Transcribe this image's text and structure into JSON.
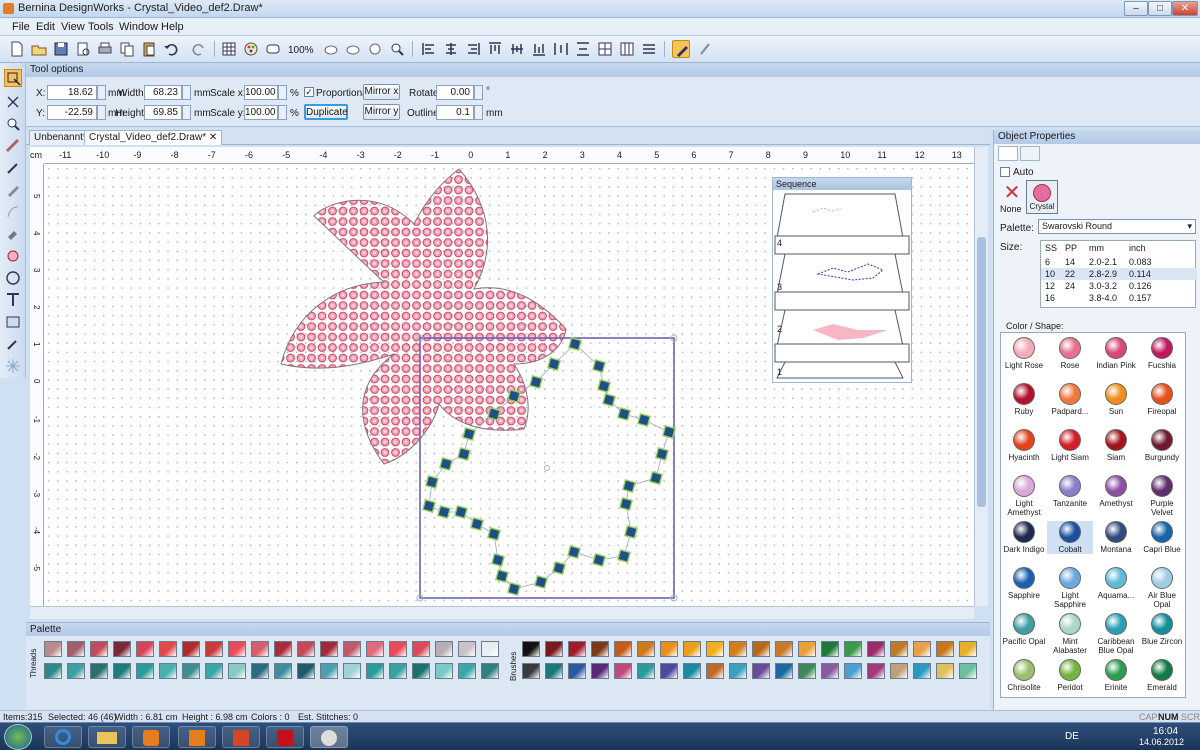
{
  "window": {
    "title": "Bernina DesignWorks - Crystal_Video_def2.Draw*",
    "min": "–",
    "max": "□",
    "close": "✕"
  },
  "menu": [
    "File",
    "Edit",
    "View",
    "Tools",
    "Window",
    "Help"
  ],
  "toolbar": {
    "zoom": "100%"
  },
  "tool_options": {
    "header": "Tool options",
    "x_label": "X:",
    "x_value": "18.62",
    "x_unit": "mm",
    "y_label": "Y:",
    "y_value": "-22.59",
    "y_unit": "mm",
    "width_label": "Width:",
    "width_value": "68.23",
    "width_unit": "mm",
    "height_label": "Height:",
    "height_value": "69.85",
    "height_unit": "mm",
    "scalex_label": "Scale x:",
    "scalex_value": "100.00",
    "scalex_unit": "%",
    "scaley_label": "Scale y:",
    "scaley_value": "100.00",
    "scaley_unit": "%",
    "proportional_label": "Proportional",
    "duplicate": "Duplicate",
    "mirror_x": "Mirror x",
    "mirror_y": "Mirror y",
    "rotate_label": "Rotate:",
    "rotate_value": "0.00",
    "rotate_unit": "°",
    "outline_label": "Outline:",
    "outline_value": "0.1",
    "outline_unit": "mm"
  },
  "doc_tabs": [
    "Unbenannt*",
    "Crystal_Video_def2.Draw*"
  ],
  "ruler": {
    "unit": "cm",
    "h_ticks": [
      "-11",
      "-10",
      "-9",
      "-8",
      "-7",
      "-6",
      "-5",
      "-4",
      "-3",
      "-2",
      "-1",
      "0",
      "1",
      "2",
      "3",
      "4",
      "5",
      "6",
      "7",
      "8",
      "9",
      "10",
      "11",
      "12",
      "13"
    ],
    "v_ticks": [
      "5",
      "4",
      "3",
      "2",
      "1",
      "0",
      "-1",
      "-2",
      "-3",
      "-4",
      "-5"
    ]
  },
  "sequence": {
    "title": "Sequence",
    "items": [
      "4",
      "3",
      "2",
      "1"
    ]
  },
  "palette": {
    "title": "Palette",
    "threads_label": "Threads",
    "brushes_label": "Brushes"
  },
  "object_properties": {
    "title": "Object Properties",
    "auto_label": "Auto",
    "none_label": "None",
    "crystal_label": "Crystal",
    "palette_label": "Palette:",
    "palette_value": "Swarovski Round",
    "size_label": "Size:",
    "size_headers": [
      "SS",
      "PP",
      "mm",
      "inch"
    ],
    "sizes": [
      [
        "6",
        "14",
        "2.0-2.1",
        "0.083"
      ],
      [
        "10",
        "22",
        "2.8-2.9",
        "0.114"
      ],
      [
        "12",
        "24",
        "3.0-3.2",
        "0.126"
      ],
      [
        "16",
        "",
        "3.8-4.0",
        "0.157"
      ]
    ],
    "color_label": "Color / Shape:",
    "colors": [
      {
        "name": "Light Rose",
        "color": "#f2aab8"
      },
      {
        "name": "Rose",
        "color": "#e8708e"
      },
      {
        "name": "Indian Pink",
        "color": "#d8457a"
      },
      {
        "name": "Fucshia",
        "color": "#c2165f"
      },
      {
        "name": "Ruby",
        "color": "#b3122e"
      },
      {
        "name": "Padpard...",
        "color": "#f1773d"
      },
      {
        "name": "Sun",
        "color": "#f08d1a"
      },
      {
        "name": "Fireopal",
        "color": "#e8501b"
      },
      {
        "name": "Hyacinth",
        "color": "#e1421e"
      },
      {
        "name": "Light Siam",
        "color": "#d21e26"
      },
      {
        "name": "Siam",
        "color": "#a3141e"
      },
      {
        "name": "Burgundy",
        "color": "#6e1a2c"
      },
      {
        "name": "Light Amethyst",
        "color": "#d8a8d6"
      },
      {
        "name": "Tanzanite",
        "color": "#8a7cc8"
      },
      {
        "name": "Amethyst",
        "color": "#8e4fa0"
      },
      {
        "name": "Purple Velvet",
        "color": "#5e2f6e"
      },
      {
        "name": "Dark Indigo",
        "color": "#1e2a52"
      },
      {
        "name": "Cobalt",
        "color": "#1c4fa0"
      },
      {
        "name": "Montana",
        "color": "#2e4d7c"
      },
      {
        "name": "Capri Blue",
        "color": "#1565a8"
      },
      {
        "name": "Sapphire",
        "color": "#1c5fb1"
      },
      {
        "name": "Light Sapphire",
        "color": "#6aa9de"
      },
      {
        "name": "Aquama...",
        "color": "#5fb9d8"
      },
      {
        "name": "Air Blue Opal",
        "color": "#9fcde6"
      },
      {
        "name": "Pacific Opal",
        "color": "#3f9fa3"
      },
      {
        "name": "Mint Alabaster",
        "color": "#a9d8c2"
      },
      {
        "name": "Caribbean Blue Opal",
        "color": "#2a9fb6"
      },
      {
        "name": "Blue Zircon",
        "color": "#118fa0"
      },
      {
        "name": "Chrisolite",
        "color": "#9bbf6c"
      },
      {
        "name": "Peridot",
        "color": "#74b33f"
      },
      {
        "name": "Erinite",
        "color": "#2c9c4d"
      },
      {
        "name": "Emerald",
        "color": "#117a45"
      }
    ]
  },
  "status": {
    "items": "Items:315",
    "selected": "Selected: 46 (46)",
    "width": "Width : 6.81 cm",
    "height": "Height : 6.98 cm",
    "colors": "Colors : 0",
    "stitches": "Est. Stitches: 0",
    "cap": "CAP",
    "num": "NUM",
    "scrl": "SCRL"
  },
  "taskbar": {
    "lang": "DE",
    "time": "16:04",
    "date": "14.06.2012"
  }
}
